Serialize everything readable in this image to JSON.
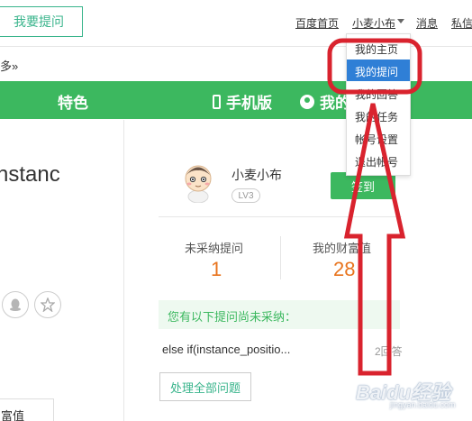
{
  "header": {
    "ask_button": "我要提问",
    "links": {
      "home": "百度首页",
      "username": "小麦小布",
      "messages": "消息",
      "private_msg": "私信"
    }
  },
  "breadcrumb": "多»",
  "nav": {
    "featured": "特色",
    "mobile": "手机版",
    "my_partial": "我的"
  },
  "question": {
    "title_partial": "nstanc"
  },
  "wealth_partial": "富值",
  "user_card": {
    "name": "小麦小布",
    "level": "LV3",
    "signin_button": "签到",
    "stats": {
      "unadopted_label": "未采纳提问",
      "unadopted_value": "1",
      "wealth_label": "我的财富值",
      "wealth_value": "28"
    },
    "notice": "您有以下提问尚未采纳：",
    "pending_question": "else if(instance_positio...",
    "pending_answers": "2回答",
    "handle_all_button": "处理全部问题"
  },
  "dropdown": {
    "items": [
      "我的主页",
      "我的提问",
      "我的回答",
      "我的任务",
      "帐号设置",
      "退出帐号"
    ],
    "active_index": 1
  },
  "colors": {
    "nav_green": "#3cb85f",
    "accent_orange": "#e8741e",
    "menu_highlight": "#2f7fd6",
    "annotation_red": "#d9232e"
  },
  "watermark": {
    "brand": "Baidu经验",
    "url": "jingyan.baidu.com"
  }
}
